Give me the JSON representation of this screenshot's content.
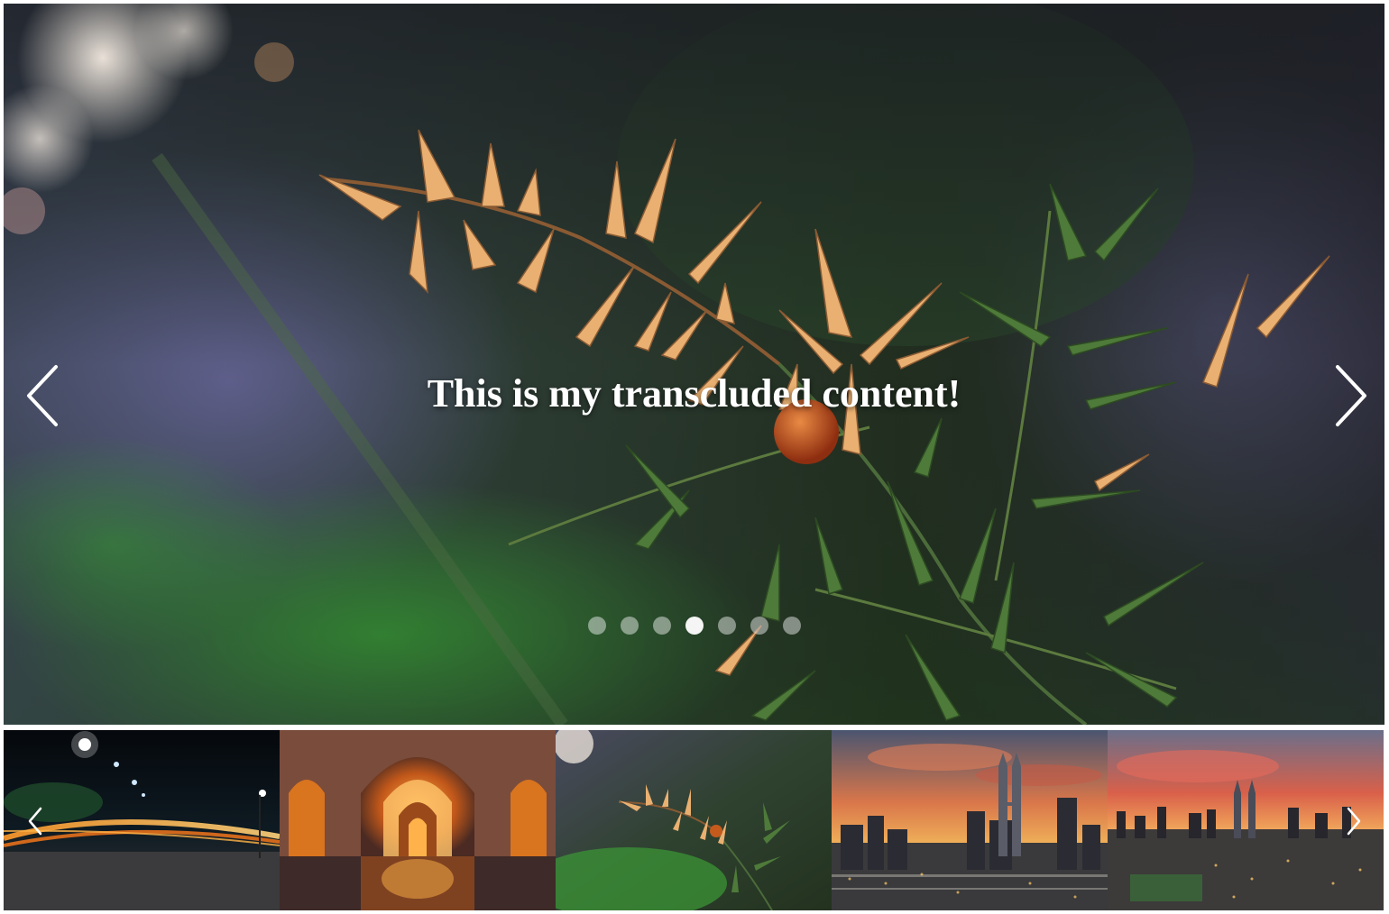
{
  "slide": {
    "caption": "This is my transcluded content!",
    "active_index": 3,
    "total_slides": 7
  },
  "controls": {
    "prev_icon": "chevron-left-icon",
    "next_icon": "chevron-right-icon"
  },
  "thumbnails": [
    {
      "subject": "night road with light trails"
    },
    {
      "subject": "arched corridor with reflections"
    },
    {
      "subject": "plant branch with leaves and berry"
    },
    {
      "subject": "city skyline with twin towers at sunset"
    },
    {
      "subject": "city panorama at dusk"
    }
  ],
  "colors": {
    "dot_inactive": "#ffffff73",
    "dot_active": "#fffffff2",
    "caption": "#ffffff"
  }
}
